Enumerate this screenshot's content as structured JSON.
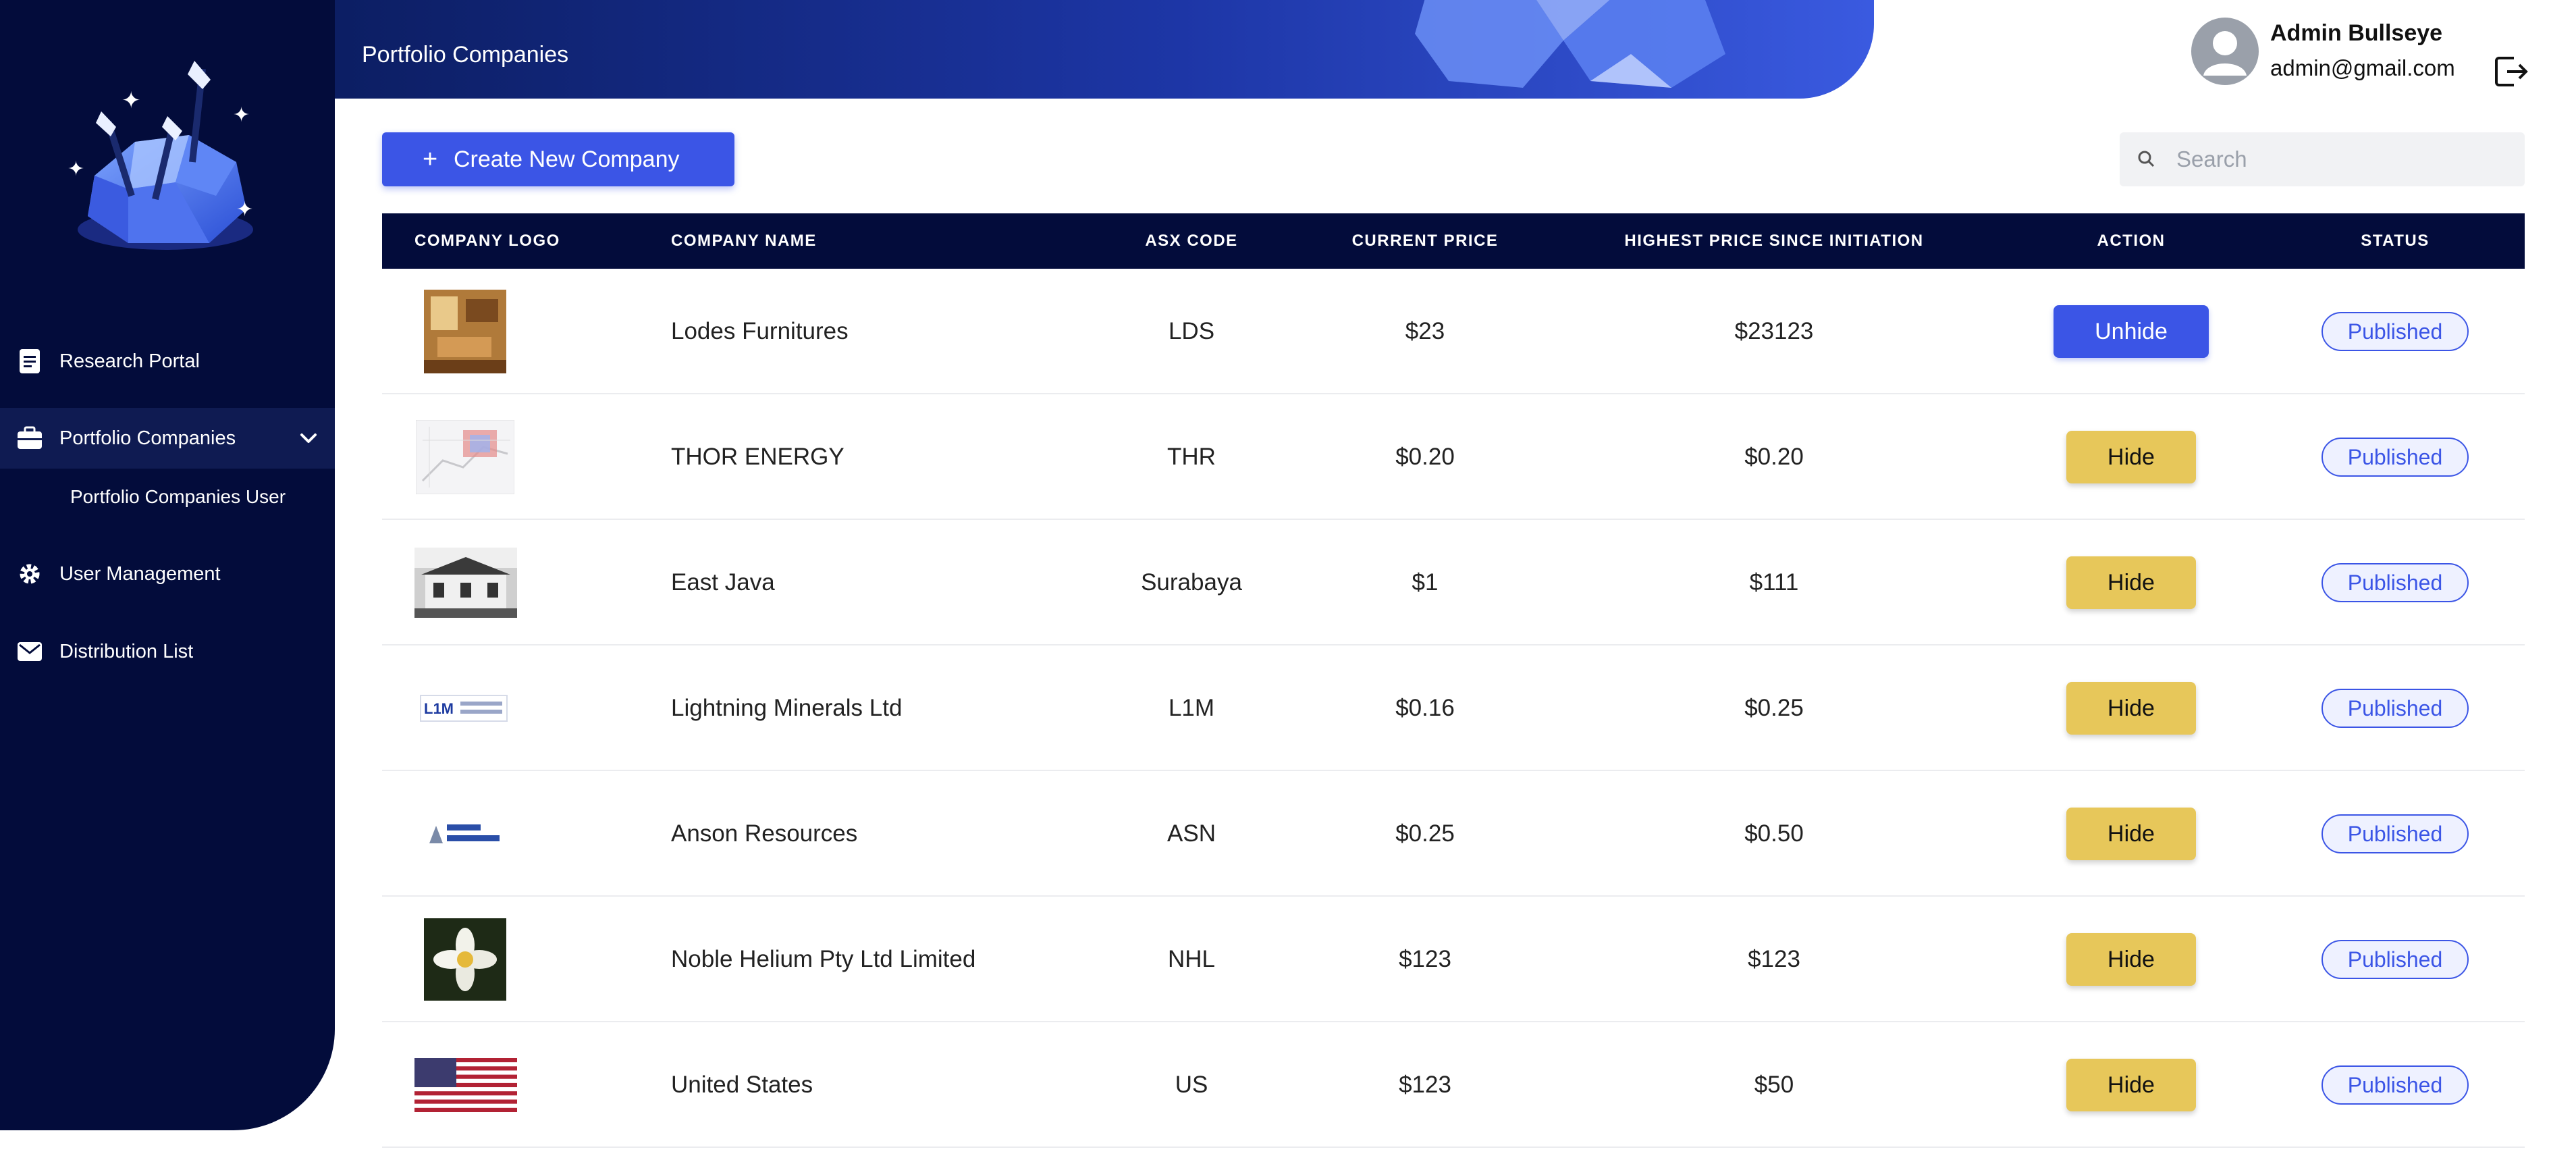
{
  "app": {
    "page_title": "Portfolio Companies",
    "brand_colors": {
      "primary": "#3b55e6",
      "navy": "#030c3b",
      "hide": "#e7c75a"
    }
  },
  "user": {
    "name": "Admin Bullseye",
    "email": "admin@gmail.com"
  },
  "sidebar": {
    "items": [
      {
        "label": "Research Portal",
        "icon": "document-icon"
      },
      {
        "label": "Portfolio Companies",
        "icon": "briefcase-icon",
        "expanded": true
      },
      {
        "label": "Portfolio Companies User",
        "icon": ""
      },
      {
        "label": "User Management",
        "icon": "gear-icon"
      },
      {
        "label": "Distribution List",
        "icon": "mail-icon"
      }
    ]
  },
  "toolbar": {
    "create_label": "Create New Company",
    "search_placeholder": "Search"
  },
  "table": {
    "headers": [
      "COMPANY LOGO",
      "COMPANY NAME",
      "ASX CODE",
      "CURRENT PRICE",
      "HIGHEST PRICE SINCE INITIATION",
      "ACTION",
      "STATUS"
    ],
    "rows": [
      {
        "logo": "furniture-room-photo",
        "name": "Lodes Furnitures",
        "code": "LDS",
        "current": "$23",
        "highest": "$23123",
        "action": "Unhide",
        "status": "Published"
      },
      {
        "logo": "map-logo",
        "name": "THOR ENERGY",
        "code": "THR",
        "current": "$0.20",
        "highest": "$0.20",
        "action": "Hide",
        "status": "Published"
      },
      {
        "logo": "building-photo",
        "name": "East Java",
        "code": "Surabaya",
        "current": "$1",
        "highest": "$111",
        "action": "Hide",
        "status": "Published"
      },
      {
        "logo": "lightning-minerals-logo",
        "name": "Lightning Minerals Ltd",
        "code": "L1M",
        "current": "$0.16",
        "highest": "$0.25",
        "action": "Hide",
        "status": "Published"
      },
      {
        "logo": "anson-resources-logo",
        "name": "Anson Resources",
        "code": "ASN",
        "current": "$0.25",
        "highest": "$0.50",
        "action": "Hide",
        "status": "Published"
      },
      {
        "logo": "flower-photo",
        "name": "Noble Helium Pty Ltd Limited",
        "code": "NHL",
        "current": "$123",
        "highest": "$123",
        "action": "Hide",
        "status": "Published"
      },
      {
        "logo": "us-flag",
        "name": "United States",
        "code": "US",
        "current": "$123",
        "highest": "$50",
        "action": "Hide",
        "status": "Published"
      }
    ]
  }
}
